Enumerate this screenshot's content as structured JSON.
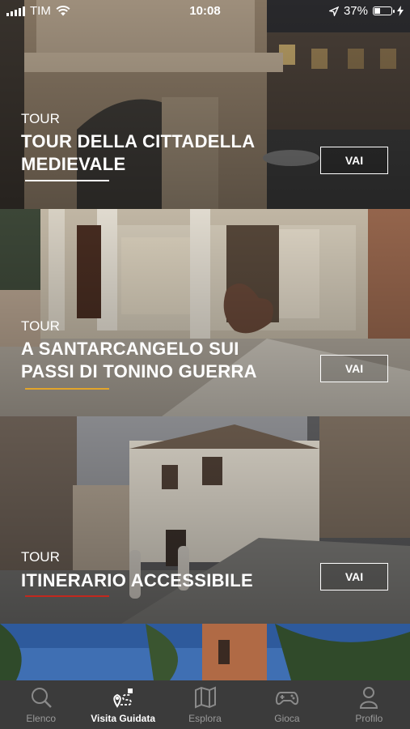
{
  "status_bar": {
    "carrier": "TIM",
    "time": "10:08",
    "battery_percent": "37%",
    "battery_level": 0.37,
    "icons": [
      "signal-icon",
      "wifi-icon",
      "location-arrow-icon",
      "battery-icon",
      "charging-icon"
    ]
  },
  "tours": [
    {
      "tag": "TOUR",
      "title": "TOUR DELLA CITTADELLA\nMEDIEVALE",
      "button": "VAI",
      "accent": "#ffffff"
    },
    {
      "tag": "TOUR",
      "title": "A SANTARCANGELO SUI\nPASSI DI TONINO GUERRA",
      "button": "VAI",
      "accent": "#e2a52a"
    },
    {
      "tag": "TOUR",
      "title": "ITINERARIO ACCESSIBILE",
      "button": "VAI",
      "accent": "#c2281e"
    }
  ],
  "tabbar": {
    "items": [
      {
        "label": "Elenco",
        "icon": "search-icon"
      },
      {
        "label": "Visita Guidata",
        "icon": "route-icon",
        "active": true
      },
      {
        "label": "Esplora",
        "icon": "map-icon"
      },
      {
        "label": "Gioca",
        "icon": "gamepad-icon"
      },
      {
        "label": "Profilo",
        "icon": "user-icon"
      }
    ],
    "background": "#3b3b3b",
    "active_color": "#ffffff",
    "inactive_color": "#9a9a9a"
  }
}
